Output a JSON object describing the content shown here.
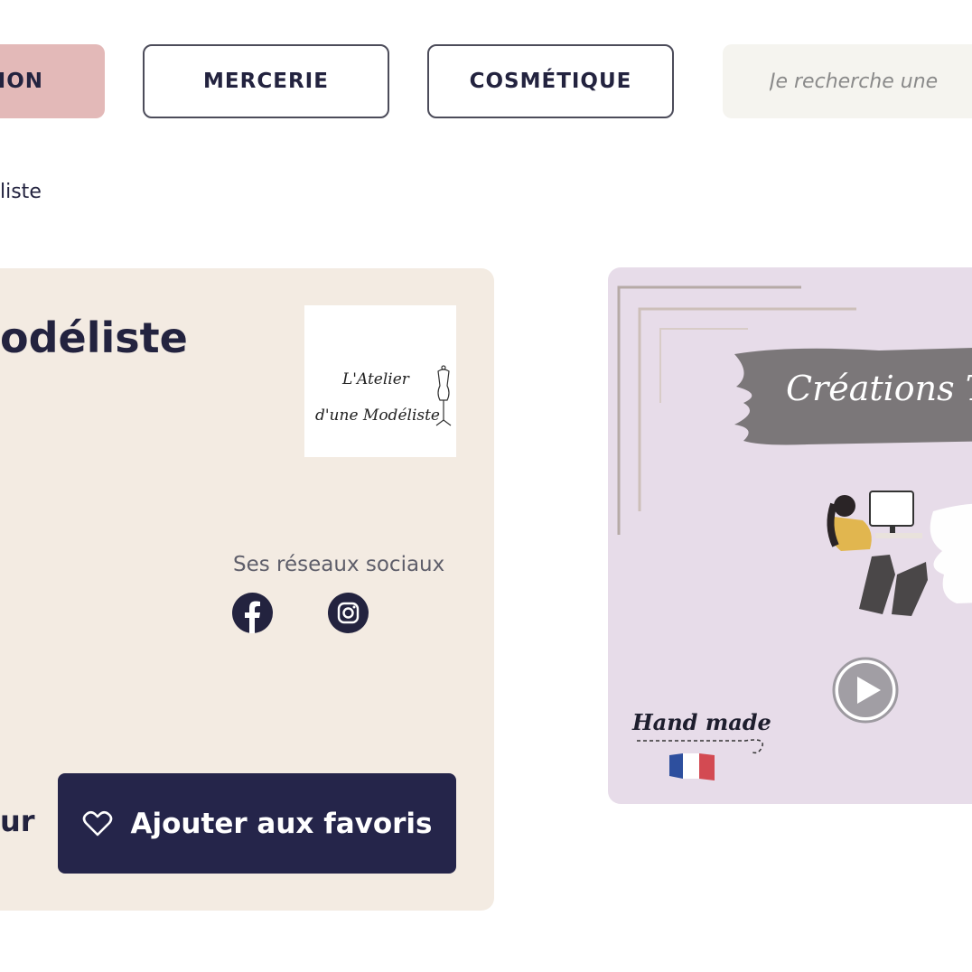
{
  "nav": {
    "active_label": "ION",
    "mercerie_label": "MERCERIE",
    "cosmetique_label": "COSMÉTIQUE"
  },
  "search": {
    "placeholder": "Je recherche une"
  },
  "breadcrumb": {
    "current": "liste"
  },
  "shop": {
    "title": "odéliste",
    "logo_text": "L'Atelier d'une Modéliste",
    "social_label": "Ses réseaux sociaux",
    "left_button_partial": "ur",
    "favorites_label": "Ajouter aux favoris"
  },
  "media": {
    "banner_text": "Créations T",
    "handmade_text": "Hand made"
  },
  "colors": {
    "navy": "#23233f",
    "active_pink": "#e3b9b8",
    "card_beige": "#f3ebe2",
    "media_lilac": "#e7dce9",
    "button_navy": "#25254a"
  },
  "icons": [
    "facebook-icon",
    "instagram-icon",
    "heart-icon",
    "play-icon",
    "dress-form-icon",
    "france-flag-icon"
  ]
}
